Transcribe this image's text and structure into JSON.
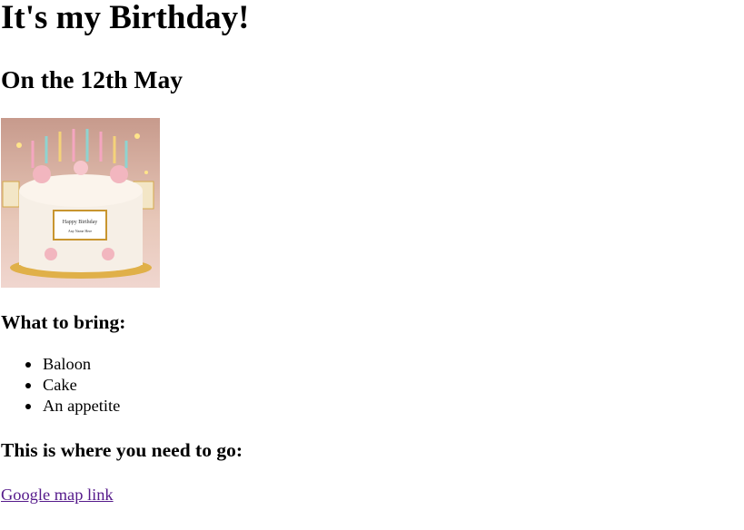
{
  "title": "It's my Birthday!",
  "subtitle": "On the 12th May",
  "image": {
    "alt": "Birthday cake",
    "cake_text": [
      "Happy Birthday",
      "Any Name Here"
    ]
  },
  "bring_heading": "What to bring:",
  "bring_items": [
    "Baloon",
    "Cake",
    "An appetite"
  ],
  "location_heading": "This is where you need to go:",
  "map_link": "Google map link",
  "colors": {
    "link_visited": "#551a8b"
  }
}
